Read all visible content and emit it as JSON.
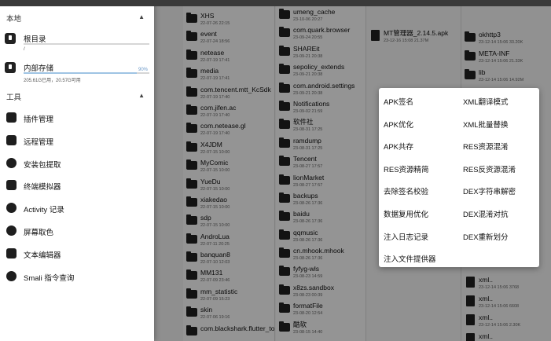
{
  "background": {
    "column1": [
      {
        "name": "XHS",
        "meta": "22-07-26 22:15"
      },
      {
        "name": "event",
        "meta": "22-07-24 18:56"
      },
      {
        "name": "netease",
        "meta": "22-07-19 17:41"
      },
      {
        "name": "media",
        "meta": "22-07-19 17:41"
      },
      {
        "name": "com.tencent.mtt_KcSdk",
        "meta": "22-07-19 17:40"
      },
      {
        "name": "com.jifen.ac",
        "meta": "22-07-19 17:40"
      },
      {
        "name": "com.netease.gl",
        "meta": "22-07-19 17:40"
      },
      {
        "name": "X4JDM",
        "meta": "22-07-15 10:00"
      },
      {
        "name": "MyComic",
        "meta": "22-07-15 10:00"
      },
      {
        "name": "YueDu",
        "meta": "22-07-15 10:00"
      },
      {
        "name": "xiakedao",
        "meta": "22-07-15 10:00"
      },
      {
        "name": "sdp",
        "meta": "22-07-15 10:00"
      },
      {
        "name": "AndroLua",
        "meta": "22-07-11 20:25"
      },
      {
        "name": "banquan8",
        "meta": "22-07-10 12:03"
      },
      {
        "name": "MM131",
        "meta": "22-07-09 23:46"
      },
      {
        "name": "mm_statistic",
        "meta": "22-07-09 15:23"
      },
      {
        "name": "skin",
        "meta": "22-07-06 19:16"
      },
      {
        "name": "com.blackshark.flutter_to",
        "meta": ""
      }
    ],
    "column2": [
      {
        "name": "umeng_cache",
        "meta": "23-10-06 20:27"
      },
      {
        "name": "com.quark.browser",
        "meta": "23-09-24 20:55"
      },
      {
        "name": "SHAREit",
        "meta": "23-09-21 20:38"
      },
      {
        "name": "sepolicy_extends",
        "meta": "23-09-21 20:38"
      },
      {
        "name": "com.android.settings",
        "meta": "23-09-21 20:38"
      },
      {
        "name": "Notifications",
        "meta": "23-09-02 21:59"
      },
      {
        "name": "软件社",
        "meta": "23-08-31 17:25"
      },
      {
        "name": "ramdump",
        "meta": "23-08-31 17:25"
      },
      {
        "name": "Tencent",
        "meta": "23-08-27 17:57"
      },
      {
        "name": "lionMarket",
        "meta": "23-08-27 17:57"
      },
      {
        "name": "backups",
        "meta": "23-08-26 17:36"
      },
      {
        "name": "baidu",
        "meta": "23-08-26 17:36"
      },
      {
        "name": "qqmusic",
        "meta": "23-08-26 17:36"
      },
      {
        "name": "cn.mhook.mhook",
        "meta": "23-08-26 17:36"
      },
      {
        "name": "fyfyg-wls",
        "meta": "23-08-23 14:59"
      },
      {
        "name": "x8zs.sandbox",
        "meta": "23-08-23 00:39"
      },
      {
        "name": "formatFile",
        "meta": "23-08-20 12:54"
      },
      {
        "name": "酷软",
        "meta": "23-08-15 14:40"
      }
    ],
    "column3": [
      {
        "name": "MT管理器_2.14.5.apk",
        "meta": "23-12-16 15:08 21.37M"
      }
    ],
    "column4": [
      {
        "name": "okhttp3",
        "meta": "23-12-14 15:06 33.20K"
      },
      {
        "name": "META-INF",
        "meta": "23-12-14 15:06 21.33K"
      },
      {
        "name": "lib",
        "meta": "23-12-14 15:06 14.92M"
      },
      {
        "name": "xml..",
        "meta": "23-12-14 15:06 3768"
      },
      {
        "name": "xml..",
        "meta": "23-12-14 15:06 6608"
      },
      {
        "name": "xml..",
        "meta": "23-12-14 15:06 2.30K"
      },
      {
        "name": "xml..",
        "meta": "23-12-14 15:06 6608"
      }
    ]
  },
  "drawer": {
    "local_header": "本地",
    "storages": [
      {
        "name": "根目录",
        "sub": "/",
        "fill_percent": 0,
        "pct_label": ""
      },
      {
        "name": "内部存储",
        "sub": "205.61G已用，20.57G可用",
        "fill_percent": 90,
        "pct_label": "90%"
      }
    ],
    "tools_header": "工具",
    "tools": [
      {
        "label": "插件管理",
        "icon": "puzzle-icon"
      },
      {
        "label": "远程管理",
        "icon": "remote-icon"
      },
      {
        "label": "安装包提取",
        "icon": "layers-icon"
      },
      {
        "label": "终端模拟器",
        "icon": "terminal-icon"
      },
      {
        "label": "Activity 记录",
        "icon": "info-icon"
      },
      {
        "label": "屏幕取色",
        "icon": "eyedropper-icon"
      },
      {
        "label": "文本编辑器",
        "icon": "text-editor-icon"
      },
      {
        "label": "Smali 指令查询",
        "icon": "search-icon"
      }
    ]
  },
  "popup_menu": {
    "left": [
      "APK签名",
      "APK优化",
      "APK共存",
      "RES资源精简",
      "去除签名校验",
      "数据复用优化",
      "注入日志记录",
      "注入文件提供器"
    ],
    "right": [
      "XML翻译模式",
      "XML批量替换",
      "RES资源混淆",
      "RES反资源混淆",
      "DEX字符串解密",
      "DEX混淆对抗",
      "DEX重新划分"
    ]
  }
}
